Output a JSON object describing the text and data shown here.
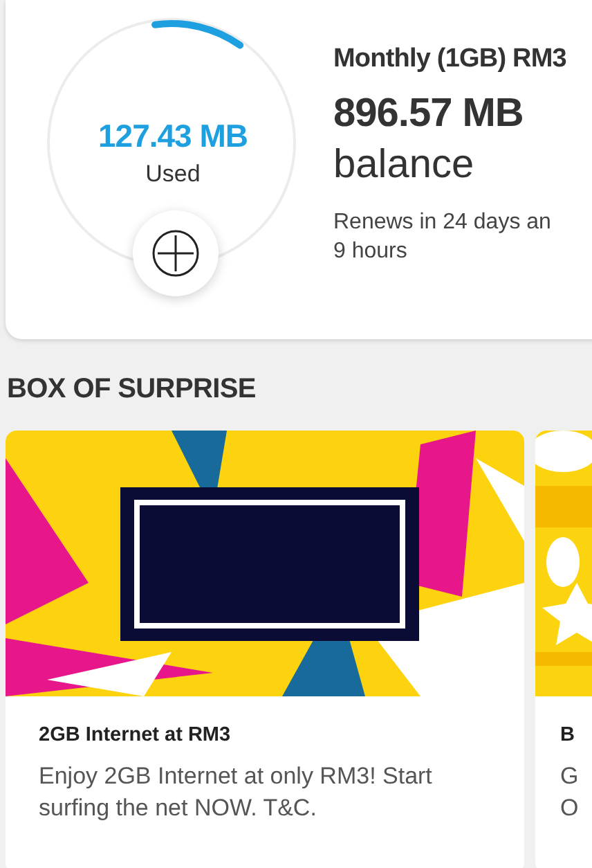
{
  "usage": {
    "used_amount": "127.43 MB",
    "used_label": "Used",
    "plan": "Monthly (1GB) RM3",
    "balance_amount": "896.57 MB",
    "balance_label": "balance",
    "renewal_lines": [
      "Renews in 24 days an",
      "9 hours"
    ]
  },
  "section_title": "BOX OF SURPRISE",
  "offers": [
    {
      "kind": "starburst",
      "title": "2GB Internet at RM3",
      "description_lines": [
        "Enjoy 2GB Internet at only RM3! Start",
        "surfing the net NOW. T&C."
      ]
    },
    {
      "kind": "comic",
      "title": "B",
      "description_lines": [
        "G",
        "O"
      ]
    }
  ]
}
